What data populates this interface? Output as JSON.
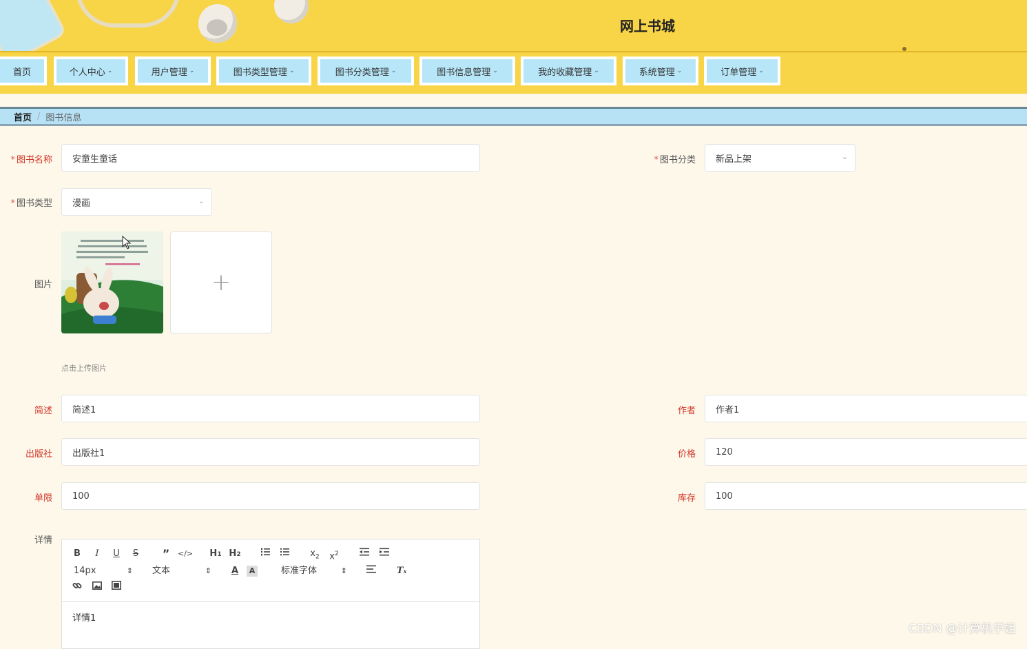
{
  "header": {
    "title": "网上书城"
  },
  "nav": {
    "items": [
      {
        "label": "首页",
        "has_menu": false
      },
      {
        "label": "个人中心",
        "has_menu": true
      },
      {
        "label": "用户管理",
        "has_menu": true
      },
      {
        "label": "图书类型管理",
        "has_menu": true
      },
      {
        "label": "图书分类管理",
        "has_menu": true
      },
      {
        "label": "图书信息管理",
        "has_menu": true
      },
      {
        "label": "我的收藏管理",
        "has_menu": true
      },
      {
        "label": "系统管理",
        "has_menu": true
      },
      {
        "label": "订单管理",
        "has_menu": true
      }
    ]
  },
  "breadcrumb": {
    "home": "首页",
    "separator": "/",
    "current": "图书信息"
  },
  "form": {
    "book_name": {
      "label": "图书名称",
      "value": "安童生童话",
      "required": true
    },
    "book_category": {
      "label": "图书分类",
      "value": "新品上架",
      "required": true
    },
    "book_type": {
      "label": "图书类型",
      "value": "漫画",
      "required": true
    },
    "image": {
      "label": "图片",
      "hint": "点击上传图片",
      "add_symbol": "+"
    },
    "summary": {
      "label": "简述",
      "value": "简述1"
    },
    "author": {
      "label": "作者",
      "value": "作者1"
    },
    "publisher": {
      "label": "出版社",
      "value": "出版社1"
    },
    "price": {
      "label": "价格",
      "value": "120"
    },
    "limit": {
      "label": "单限",
      "value": "100"
    },
    "stock": {
      "label": "库存",
      "value": "100"
    },
    "details": {
      "label": "详情",
      "value": "详情1"
    }
  },
  "editor": {
    "font_size": "14px",
    "header_style": "文本",
    "font_family": "标准字体"
  },
  "watermark": "CSDN @计算机学姐",
  "colors": {
    "header_bg": "#f8d447",
    "nav_item_bg": "#b7e6f8",
    "breadcrumb_bg": "#b7e2f6",
    "page_bg": "#fdf8ea",
    "label_red": "#d2382a"
  }
}
